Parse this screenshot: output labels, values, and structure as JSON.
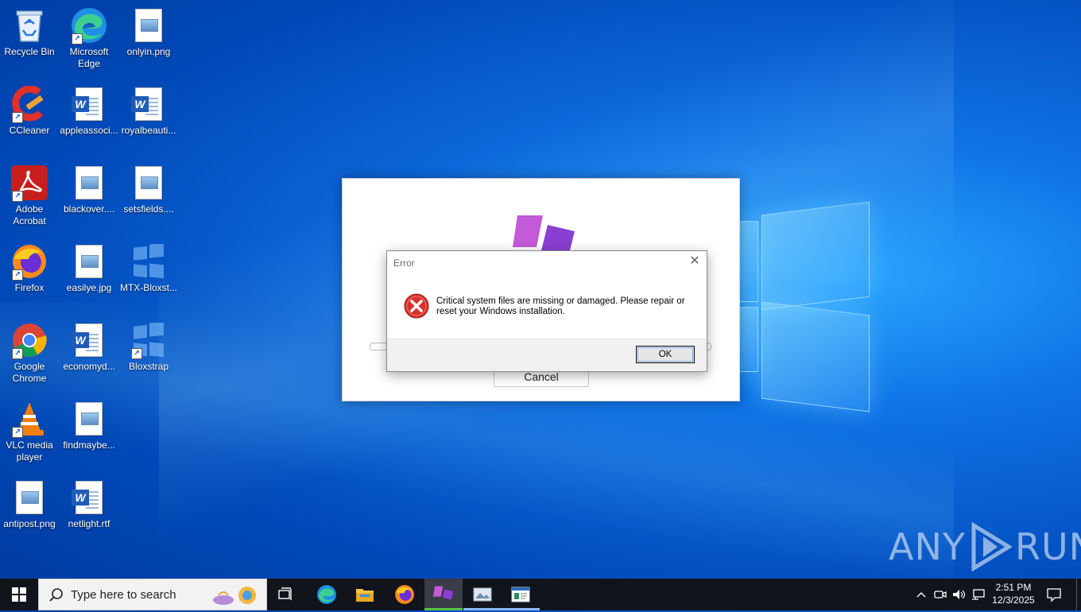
{
  "desktop": {
    "icons": [
      {
        "label": "Recycle Bin"
      },
      {
        "label": "Microsoft Edge"
      },
      {
        "label": "onlyin.png"
      },
      {
        "label": "CCleaner"
      },
      {
        "label": "appleassoci..."
      },
      {
        "label": "royalbeauti..."
      },
      {
        "label": "Adobe Acrobat"
      },
      {
        "label": "blackover...."
      },
      {
        "label": "setsfields...."
      },
      {
        "label": "Firefox"
      },
      {
        "label": "easilye.jpg"
      },
      {
        "label": "MTX-Bloxst..."
      },
      {
        "label": "Google Chrome"
      },
      {
        "label": "economyd..."
      },
      {
        "label": "Bloxstrap"
      },
      {
        "label": "VLC media player"
      },
      {
        "label": "findmaybe..."
      },
      {
        "label": "antipost.png"
      },
      {
        "label": "netlight.rtf"
      }
    ]
  },
  "app_window": {
    "cancel_label": "Cancel"
  },
  "dialog": {
    "title": "Error",
    "message": "Critical system files are missing or damaged. Please repair or reset your Windows installation.",
    "ok_label": "OK",
    "close_glyph": "✕"
  },
  "watermark": {
    "left": "ANY",
    "right": "RUN"
  },
  "taskbar": {
    "search_placeholder": "Type here to search",
    "time": "2:51 PM",
    "date": "12/3/2025"
  },
  "colors": {
    "taskbar": "#12141c",
    "error_red": "#d9312b",
    "bloxstrap_purple": "#a455d9"
  }
}
